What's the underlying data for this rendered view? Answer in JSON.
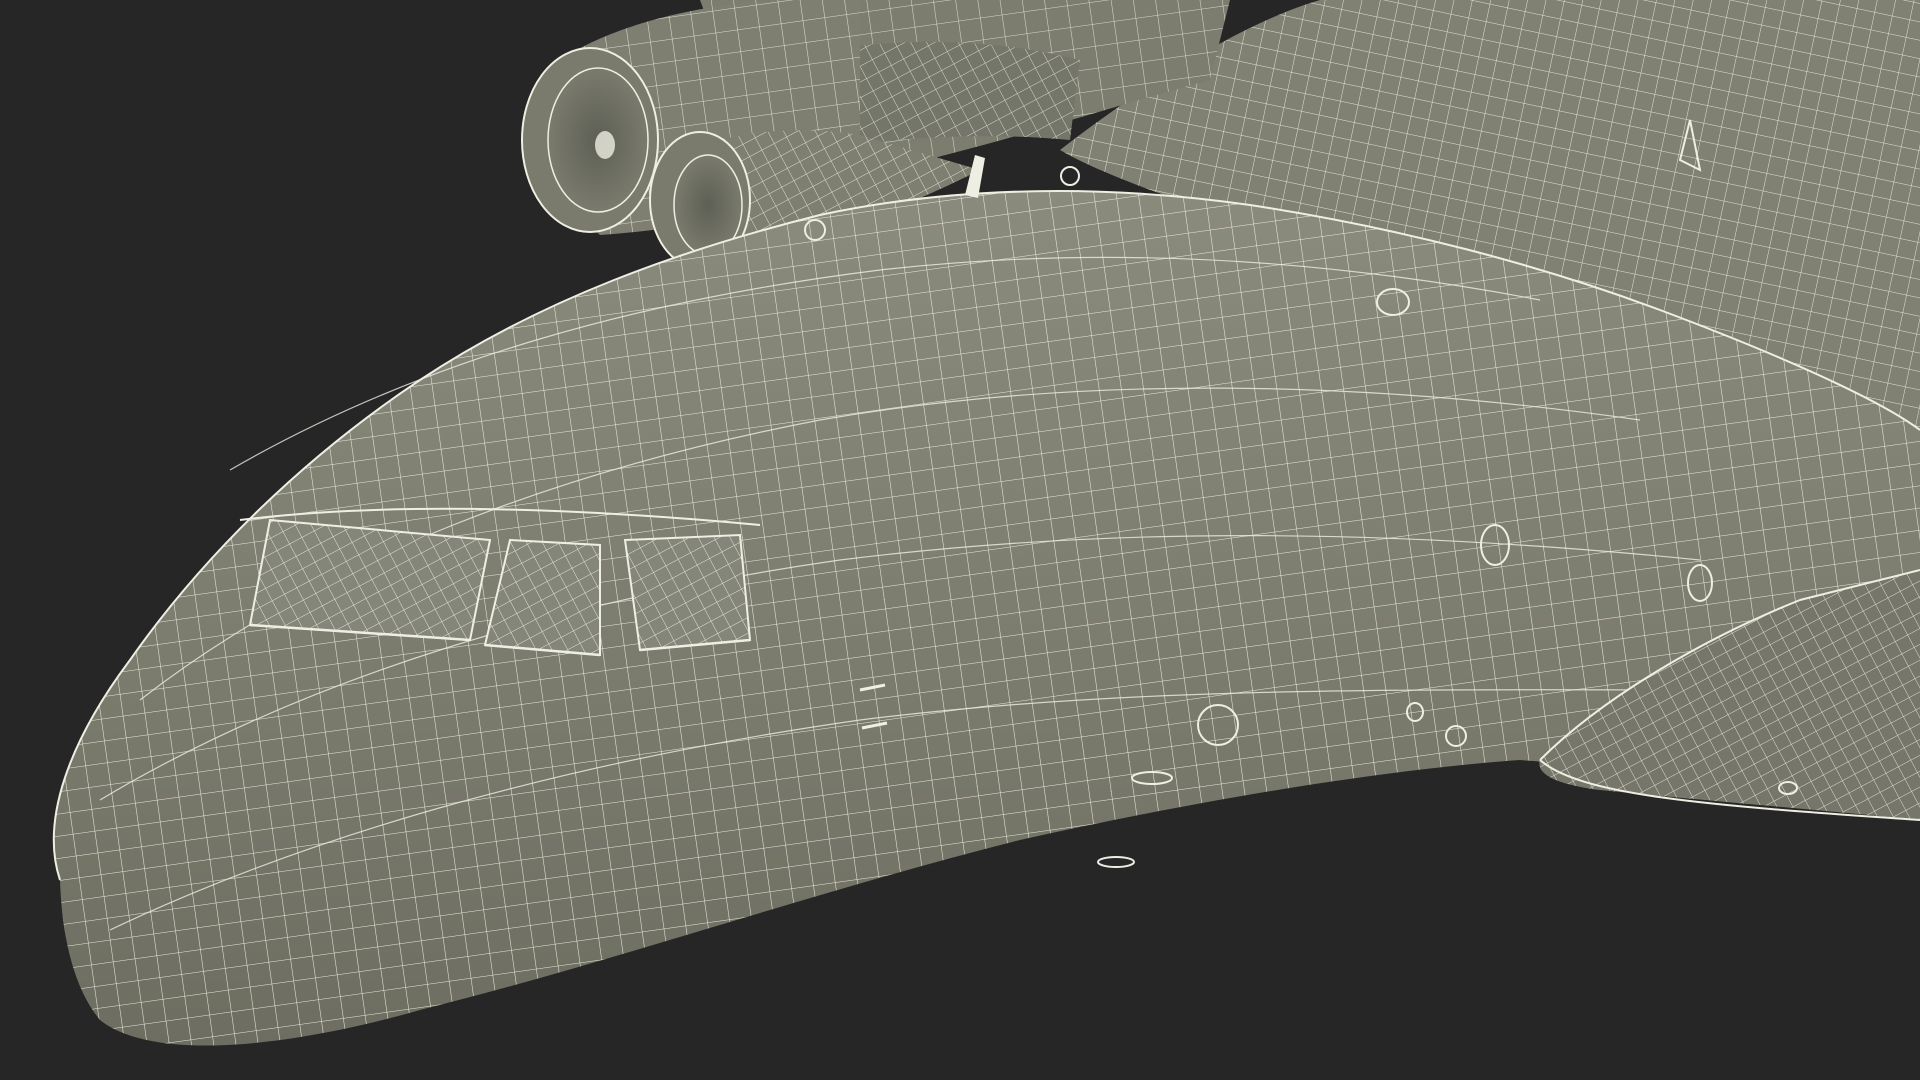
{
  "scene": {
    "subject": "aircraft-forward-fuselage-wireframe",
    "colors": {
      "background": "#262626",
      "surface": "#7d7e70",
      "surface_shade": "#6a6b5f",
      "wire": "#efeee2"
    }
  }
}
